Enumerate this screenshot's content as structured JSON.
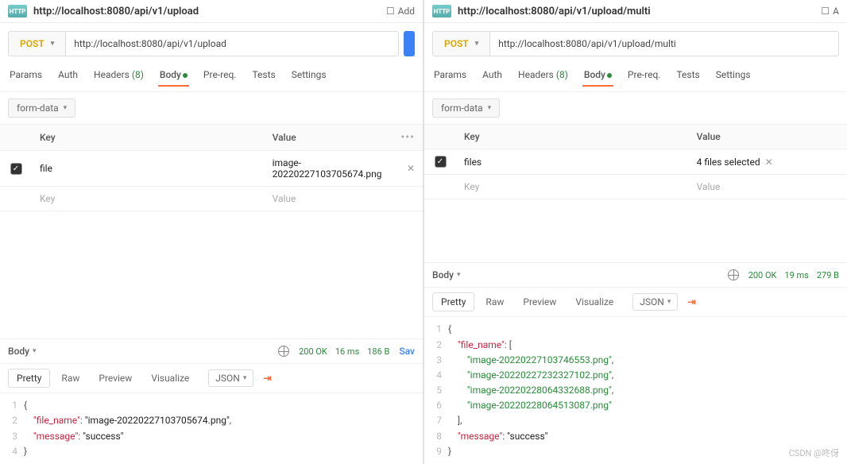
{
  "watermark": "CSDN @咚伢",
  "left": {
    "tab_title": "http://localhost:8080/api/v1/upload",
    "add_label": "Add",
    "method": "POST",
    "url": "http://localhost:8080/api/v1/upload",
    "req_tabs": {
      "params": "Params",
      "auth": "Auth",
      "headers": "Headers",
      "headers_n": "(8)",
      "body": "Body",
      "prereq": "Pre-req.",
      "tests": "Tests",
      "settings": "Settings"
    },
    "body_type": "form-data",
    "kv": {
      "key_hdr": "Key",
      "val_hdr": "Value",
      "rows": [
        {
          "checked": true,
          "key": "file",
          "value": "image-20220227103705674.png"
        }
      ],
      "ph_key": "Key",
      "ph_val": "Value"
    },
    "resp_label": "Body",
    "status": {
      "code": "200 OK",
      "time": "16 ms",
      "size": "186 B"
    },
    "save": "Sav",
    "view_tabs": {
      "pretty": "Pretty",
      "raw": "Raw",
      "preview": "Preview",
      "visualize": "Visualize",
      "json": "JSON"
    },
    "json_lines": [
      {
        "n": "1",
        "txt": "{"
      },
      {
        "n": "2",
        "txt": "    \"file_name\": \"image-20220227103705674.png\","
      },
      {
        "n": "3",
        "txt": "    \"message\": \"success\""
      },
      {
        "n": "4",
        "txt": "}"
      }
    ]
  },
  "right": {
    "tab_title": "http://localhost:8080/api/v1/upload/multi",
    "add_label": "A",
    "method": "POST",
    "url": "http://localhost:8080/api/v1/upload/multi",
    "req_tabs": {
      "params": "Params",
      "auth": "Auth",
      "headers": "Headers",
      "headers_n": "(8)",
      "body": "Body",
      "prereq": "Pre-req.",
      "tests": "Tests",
      "settings": "Settings"
    },
    "body_type": "form-data",
    "kv": {
      "key_hdr": "Key",
      "val_hdr": "Value",
      "rows": [
        {
          "checked": true,
          "key": "files",
          "value": "4 files selected"
        }
      ],
      "ph_key": "Key",
      "ph_val": "Value"
    },
    "resp_label": "Body",
    "status": {
      "code": "200 OK",
      "time": "19 ms",
      "size": "279 B"
    },
    "view_tabs": {
      "pretty": "Pretty",
      "raw": "Raw",
      "preview": "Preview",
      "visualize": "Visualize",
      "json": "JSON"
    },
    "json_lines": [
      {
        "n": "1",
        "txt": "{"
      },
      {
        "n": "2",
        "txt": "    \"file_name\": ["
      },
      {
        "n": "3",
        "txt": "        \"image-20220227103746553.png\","
      },
      {
        "n": "4",
        "txt": "        \"image-20220227232327102.png\","
      },
      {
        "n": "5",
        "txt": "        \"image-20220228064332688.png\","
      },
      {
        "n": "6",
        "txt": "        \"image-20220228064513087.png\""
      },
      {
        "n": "7",
        "txt": "    ],"
      },
      {
        "n": "8",
        "txt": "    \"message\": \"success\""
      },
      {
        "n": "9",
        "txt": "}"
      }
    ]
  }
}
